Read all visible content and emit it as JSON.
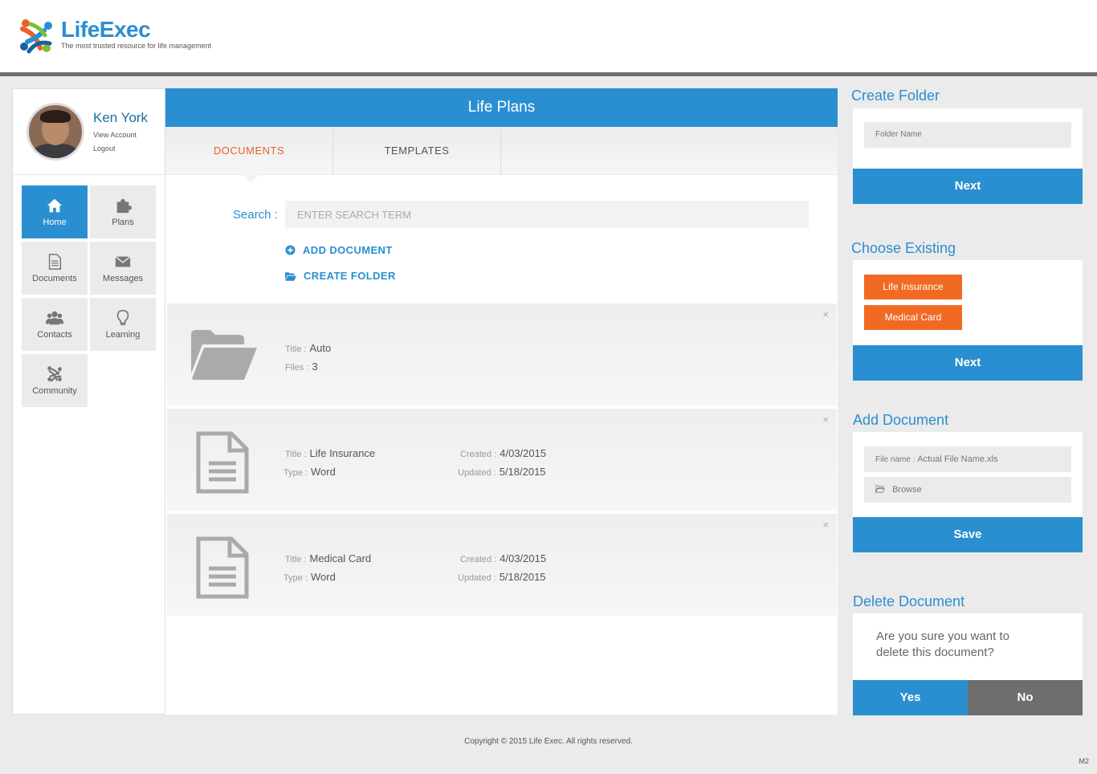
{
  "brand": {
    "name": "LifeExec",
    "tagline": "The most trusted resource for life management"
  },
  "user": {
    "name": "Ken York",
    "view_account": "View Account",
    "logout": "Logout"
  },
  "nav": [
    {
      "label": "Home",
      "icon": "home-icon",
      "active": true
    },
    {
      "label": "Plans",
      "icon": "puzzle-icon"
    },
    {
      "label": "Documents",
      "icon": "document-icon"
    },
    {
      "label": "Messages",
      "icon": "envelope-icon"
    },
    {
      "label": "Contacts",
      "icon": "users-icon"
    },
    {
      "label": "Learning",
      "icon": "lightbulb-icon"
    },
    {
      "label": "Community",
      "icon": "community-icon"
    }
  ],
  "main": {
    "title": "Life Plans",
    "tabs": [
      {
        "label": "DOCUMENTS",
        "active": true
      },
      {
        "label": "TEMPLATES"
      }
    ],
    "search": {
      "label": "Search :",
      "placeholder": "ENTER SEARCH TERM"
    },
    "actions": {
      "add_document": "ADD DOCUMENT",
      "create_folder": "CREATE FOLDER"
    },
    "items": [
      {
        "kind": "folder",
        "title_label": "Title :",
        "title": "Auto",
        "files_label": "Files :",
        "files": "3"
      },
      {
        "kind": "document",
        "title_label": "Title :",
        "title": "Life Insurance",
        "type_label": "Type :",
        "type": "Word",
        "created_label": "Created :",
        "created": "4/03/2015",
        "updated_label": "Updated :",
        "updated": "5/18/2015"
      },
      {
        "kind": "document",
        "title_label": "Title :",
        "title": "Medical Card",
        "type_label": "Type :",
        "type": "Word",
        "created_label": "Created :",
        "created": "4/03/2015",
        "updated_label": "Updated :",
        "updated": "5/18/2015"
      }
    ],
    "close_glyph": "×"
  },
  "create_folder": {
    "title": "Create Folder",
    "placeholder": "Folder Name",
    "next": "Next"
  },
  "choose_existing": {
    "title": "Choose Existing",
    "options": [
      "Life Insurance",
      "Medical Card"
    ],
    "next": "Next"
  },
  "add_document": {
    "title": "Add Document",
    "file_label": "File name :",
    "file_value": "Actual File Name.xls",
    "browse": "Browse",
    "save": "Save"
  },
  "delete_document": {
    "title": "Delete Document",
    "message": "Are you sure you want to delete this document?",
    "yes": "Yes",
    "no": "No"
  },
  "footer": {
    "copyright": "Copyright  ©  2015  Life Exec.   All rights reserved.",
    "page_code": "M2"
  },
  "colors": {
    "primary": "#2a8fd0",
    "accent": "#e8622a",
    "orange": "#f06a24",
    "gray": "#6e6e6e"
  }
}
